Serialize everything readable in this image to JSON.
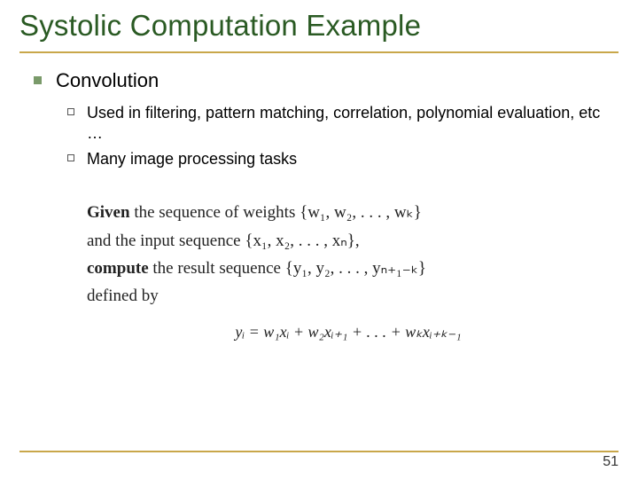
{
  "title": "Systolic Computation Example",
  "level1": "Convolution",
  "level2": [
    "Used in filtering, pattern matching, correlation, polynomial evaluation, etc …",
    "Many image processing tasks"
  ],
  "math": {
    "line1_bold": "Given",
    "line1_rest": " the sequence of weights {w₁, w₂, . . . , wₖ}",
    "line2": "and the input sequence {x₁, x₂, . . . , xₙ},",
    "line3_bold": "compute",
    "line3_rest": " the result sequence {y₁, y₂, . . . , yₙ₊₁₋ₖ}",
    "line4": "defined by",
    "equation": "yᵢ = w₁xᵢ + w₂xᵢ₊₁ + . . . + wₖxᵢ₊ₖ₋₁"
  },
  "page_number": "51"
}
